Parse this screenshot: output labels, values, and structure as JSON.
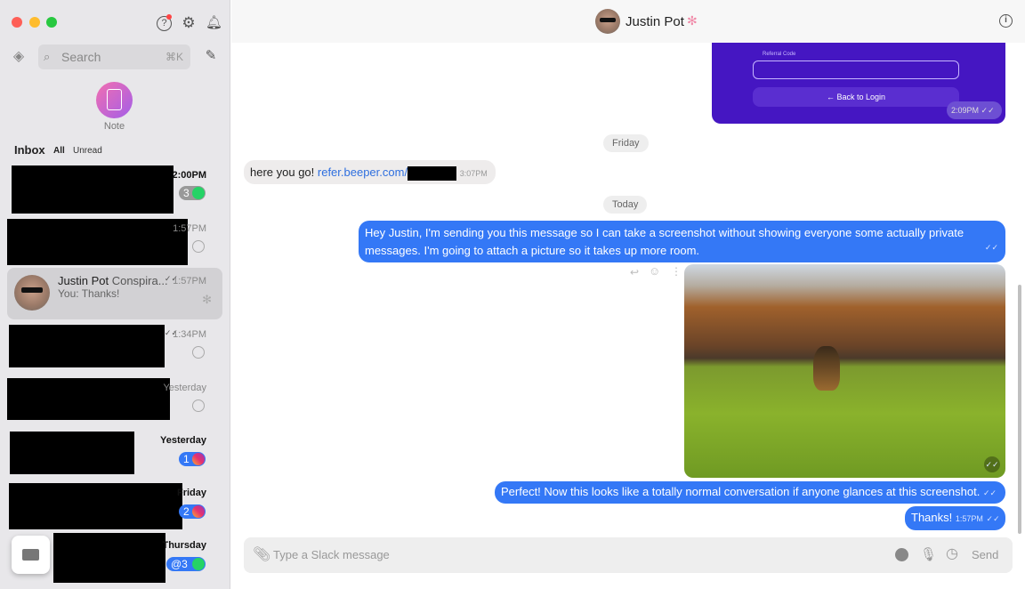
{
  "sidebar": {
    "search": {
      "placeholder": "Search",
      "shortcut": "⌘K"
    },
    "note_label": "Note",
    "inbox": {
      "title": "Inbox",
      "filters": [
        "All",
        "Unread"
      ]
    },
    "chats": [
      {
        "name": "",
        "preview": "",
        "time": "2:00PM",
        "unread": "3",
        "network": "whatsapp",
        "bold": true
      },
      {
        "name": "",
        "preview": "",
        "time": "1:57PM",
        "network": "whatsapp"
      },
      {
        "name": "Justin Pot",
        "name_suffix": " Conspira...",
        "preview": "You: Thanks!",
        "time": "1:57PM",
        "network": "slack",
        "selected": true,
        "read_ticks": "✓✓"
      },
      {
        "name": "",
        "preview": "",
        "time": "1:34PM",
        "network": "whatsapp",
        "read_ticks": "✓✓"
      },
      {
        "name": "",
        "preview": "",
        "time": "Yesterday",
        "network": "whatsapp"
      },
      {
        "name": "",
        "preview": "",
        "time": "Yesterday",
        "unread": "1",
        "network": "instagram",
        "bold": true
      },
      {
        "name": "",
        "preview": "",
        "time": "Friday",
        "unread": "2",
        "network": "instagram",
        "bold": true
      },
      {
        "name": "",
        "preview": "",
        "time": "Thursday",
        "unread": "@3",
        "network": "whatsapp",
        "bold": true
      }
    ]
  },
  "header": {
    "title": "Justin Pot",
    "network": "slack",
    "info_icon": "info-icon"
  },
  "messages": {
    "image_card": {
      "field_label": "Referral Code",
      "button": "Back to Login",
      "time": "2:09PM"
    },
    "date1": "Friday",
    "incoming": {
      "text": "here you go! ",
      "link": "refer.beeper.com/",
      "time": "3:07PM"
    },
    "date2": "Today",
    "out1": "Hey Justin, I'm sending you this message so I can take a screenshot without showing everyone some actually private messages. I'm going to attach a picture so it takes up more room.",
    "out2": "Perfect! Now this looks like a totally normal conversation if anyone glances at this screenshot.",
    "out3": {
      "text": "Thanks!",
      "time": "1:57PM"
    },
    "ticks": "✓✓"
  },
  "composer": {
    "placeholder": "Type a Slack message",
    "send": "Send"
  },
  "colors": {
    "accent": "#3478f6",
    "purple_card": "#4a17c4",
    "whatsapp": "#25d366",
    "slack": "#e01e5a"
  }
}
